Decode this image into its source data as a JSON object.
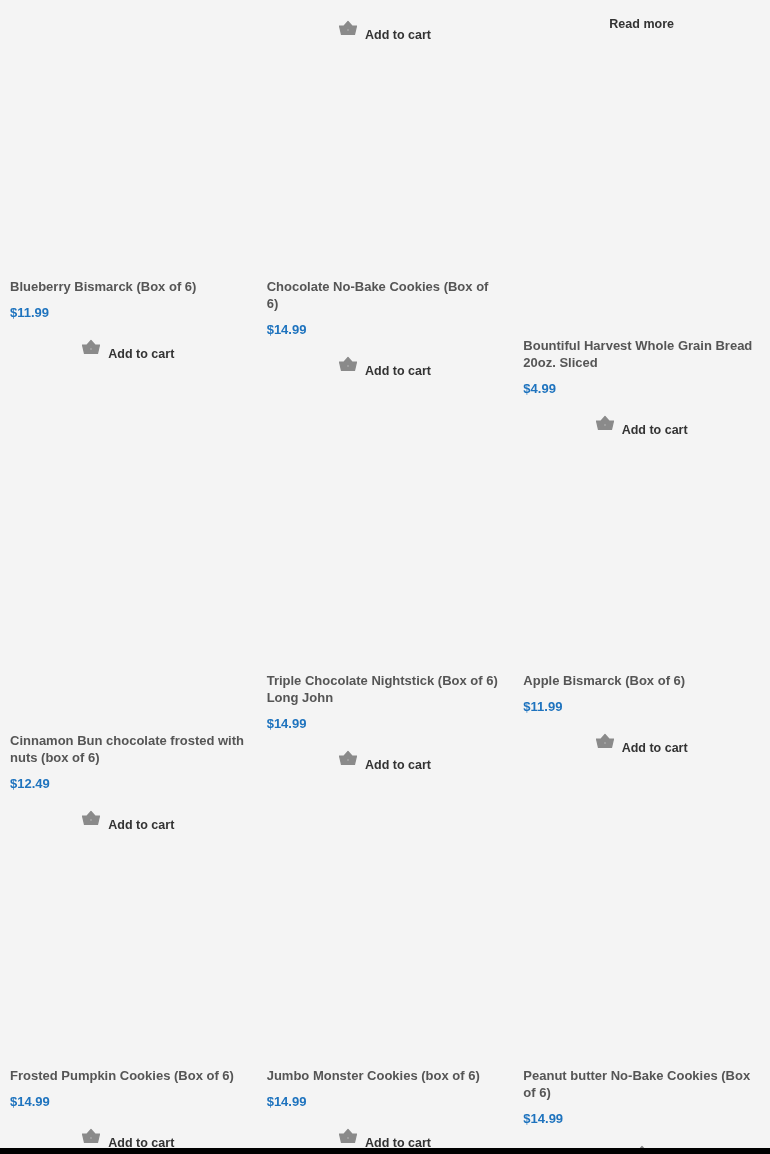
{
  "top_row": [
    {
      "button": {
        "kind": "cart",
        "label": "Add to cart"
      }
    },
    {
      "button": {
        "kind": "link",
        "label": "Read more"
      }
    }
  ],
  "rows": [
    {
      "products": [
        {
          "title": "Blueberry Bismarck (Box of 6)",
          "price": "$11.99",
          "button": {
            "kind": "cart",
            "label": "Add to cart"
          }
        },
        {
          "title": "Chocolate No-Bake Cookies (Box of 6)",
          "price": "$14.99",
          "button": {
            "kind": "cart",
            "label": "Add to cart"
          }
        },
        {
          "title": "Bountiful Harvest Whole Grain Bread 20oz. Sliced",
          "price": "$4.99",
          "button": {
            "kind": "cart",
            "label": "Add to cart"
          }
        }
      ]
    },
    {
      "products": [
        {
          "title": "Cinnamon Bun chocolate frosted with nuts (box of 6)",
          "price": "$12.49",
          "button": {
            "kind": "cart",
            "label": "Add to cart"
          }
        },
        {
          "title": "Triple Chocolate Nightstick (Box of 6) Long John",
          "price": "$14.99",
          "button": {
            "kind": "cart",
            "label": "Add to cart"
          }
        },
        {
          "title": "Apple Bismarck (Box of 6)",
          "price": "$11.99",
          "button": {
            "kind": "cart",
            "label": "Add to cart"
          }
        }
      ]
    },
    {
      "products": [
        {
          "title": "Frosted Pumpkin Cookies (Box of 6)",
          "price": "$14.99",
          "button": {
            "kind": "cart",
            "label": "Add to cart"
          }
        },
        {
          "title": "Jumbo Monster Cookies (box of 6)",
          "price": "$14.99",
          "button": {
            "kind": "cart",
            "label": "Add to cart"
          }
        },
        {
          "title": "Peanut butter No-Bake Cookies (Box of 6)",
          "price": "$14.99",
          "button": {
            "kind": "cart"
          }
        }
      ]
    }
  ]
}
